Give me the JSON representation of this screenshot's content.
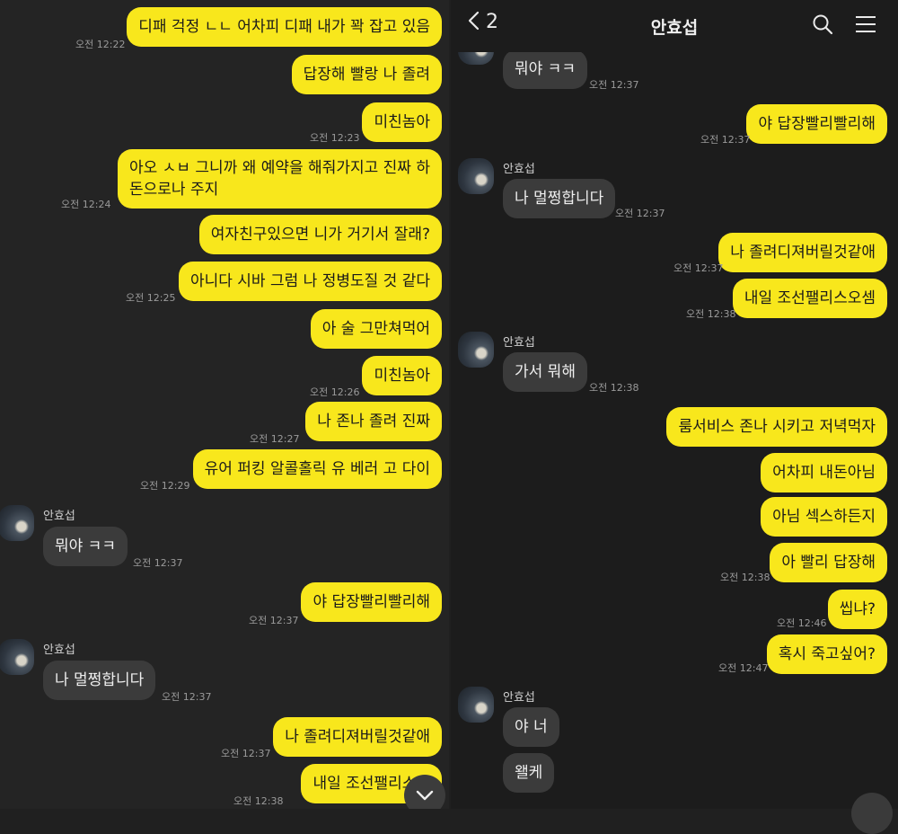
{
  "left_panel": {
    "messages": [
      {
        "text": "디패 걱정 ㄴㄴ 어차피 디패 내가 꽉 잡고 있음",
        "time": "오전 12:22"
      },
      {
        "text": "답장해 빨랑 나 졸려",
        "time": ""
      },
      {
        "text": "미친놈아",
        "time": "오전 12:23"
      },
      {
        "text": "아오 ㅅㅂ 그니까 왜 예약을 해줘가지고 진짜 하\n돈으로나 주지",
        "time": "오전 12:24"
      },
      {
        "text": "여자친구있으면 니가 거기서 잘래?",
        "time": ""
      },
      {
        "text": "아니다 시바 그럼 나 정병도질 것 같다",
        "time": "오전 12:25"
      },
      {
        "text": "아 술 그만쳐먹어",
        "time": ""
      },
      {
        "text": "미친놈아",
        "time": "오전 12:26"
      },
      {
        "text": "나 존나 졸려 진짜",
        "time": "오전 12:27"
      },
      {
        "text": "유어 퍼킹 알콜홀릭 유 베러 고 다이",
        "time": "오전 12:29"
      },
      {
        "sender": "안효섭",
        "text": "뭐야 ㅋㅋ",
        "time": "오전 12:37"
      },
      {
        "text": "야 답장빨리빨리해",
        "time": "오전 12:37"
      },
      {
        "sender": "안효섭",
        "text": "나 멀쩡합니다",
        "time": "오전 12:37"
      },
      {
        "text": "나 졸려디져버릴것같애",
        "time": "오전 12:37"
      },
      {
        "text": "내일 조선팰리스오",
        "time": "오전 12:38"
      }
    ]
  },
  "right_panel": {
    "header": {
      "back_label": "2",
      "title": "안효섭",
      "icons": [
        "search-icon",
        "menu-icon"
      ]
    },
    "messages": [
      {
        "sender": "안효섭",
        "text": "뭐야 ㅋㅋ",
        "time": "오전 12:37"
      },
      {
        "text": "야 답장빨리빨리해",
        "time": "오전 12:37"
      },
      {
        "sender": "안효섭",
        "text": "나 멀쩡합니다",
        "time": "오전 12:37"
      },
      {
        "text": "나 졸려디져버릴것같애",
        "time": "오전 12:37"
      },
      {
        "text": "내일 조선팰리스오셈",
        "time": "오전 12:38"
      },
      {
        "sender": "안효섭",
        "text": "가서 뭐해",
        "time": "오전 12:38"
      },
      {
        "text": "룸서비스 존나 시키고 저녁먹자",
        "time": ""
      },
      {
        "text": "어차피 내돈아님",
        "time": ""
      },
      {
        "text": "아님 섹스하든지",
        "time": ""
      },
      {
        "text": "아 빨리 답장해",
        "time": "오전 12:38"
      },
      {
        "text": "씹냐?",
        "time": "오전 12:46"
      },
      {
        "text": "혹시 죽고싶어?",
        "time": "오전 12:47"
      },
      {
        "sender": "안효섭",
        "text": "야 너",
        "time": ""
      },
      {
        "text": "왤케",
        "time": ""
      }
    ]
  },
  "colors": {
    "my_bubble": "#f8e71c",
    "their_bubble": "#3b3b3b",
    "background": "#242424"
  }
}
